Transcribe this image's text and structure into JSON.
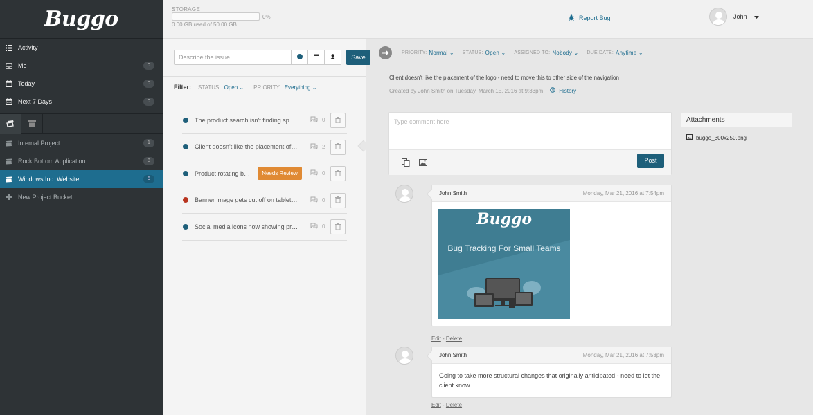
{
  "app": {
    "logo": "Buggo"
  },
  "sidebar": {
    "nav": [
      {
        "label": "Activity",
        "icon": "list-icon",
        "count": null
      },
      {
        "label": "Me",
        "icon": "inbox-icon",
        "count": "0"
      },
      {
        "label": "Today",
        "icon": "calendar-icon",
        "count": "0"
      },
      {
        "label": "Next 7 Days",
        "icon": "calendar-range-icon",
        "count": "0"
      }
    ],
    "projects": [
      {
        "label": "Internal Project",
        "count": "1"
      },
      {
        "label": "Rock Bottom Application",
        "count": "8"
      },
      {
        "label": "Windows Inc. Website",
        "count": "5"
      }
    ],
    "new_project": "New Project Bucket"
  },
  "topbar": {
    "storage_label": "STORAGE",
    "storage_percent": "0%",
    "storage_fraction": 0,
    "storage_used": "0.00 GB used of 50.00 GB",
    "report_bug": "Report Bug",
    "user_name": "John"
  },
  "newbug": {
    "placeholder": "Describe the issue",
    "save": "Save"
  },
  "filter": {
    "label": "Filter:",
    "status_key": "STATUS:",
    "status_val": "Open",
    "priority_key": "PRIORITY:",
    "priority_val": "Everything"
  },
  "bugs": [
    {
      "title": "The product search isn't finding specif...",
      "color": "#1e5f7a",
      "comments": "0",
      "badge": null
    },
    {
      "title": "Client doesn't like the placement of th...",
      "color": "#1e5f7a",
      "comments": "2",
      "badge": null
    },
    {
      "title": "Product rotating ba...",
      "color": "#1e5f7a",
      "comments": "0",
      "badge": "Needs Review"
    },
    {
      "title": "Banner image gets cut off on tablet sit...",
      "color": "#b8341f",
      "comments": "0",
      "badge": null
    },
    {
      "title": "Social media icons now showing prop...",
      "color": "#1e5f7a",
      "comments": "0",
      "badge": null
    }
  ],
  "detail": {
    "priority_key": "PRIORITY:",
    "priority_val": "Normal",
    "status_key": "STATUS:",
    "status_val": "Open",
    "assigned_key": "ASSIGNED TO:",
    "assigned_val": "Nobody",
    "due_key": "DUE DATE:",
    "due_val": "Anytime",
    "description": "Client doesn't like the placement of the logo - need to move this to other side of the navigation",
    "created": "Created by John Smith on Tuesday, March 15, 2016 at 9:33pm",
    "history": "History",
    "comment_placeholder": "Type comment here",
    "post": "Post"
  },
  "attachments": {
    "title": "Attachments",
    "files": [
      "buggo_300x250.png"
    ]
  },
  "comments": [
    {
      "author": "John Smith",
      "date": "Monday, Mar 21, 2016 at 7:54pm",
      "image": {
        "logo": "Buggo",
        "tagline": "Bug Tracking For Small Teams"
      },
      "edit": "Edit",
      "sep": " - ",
      "delete": "Delete"
    },
    {
      "author": "John Smith",
      "date": "Monday, Mar 21, 2016 at 7:53pm",
      "text": "Going to take more structural changes that originally anticipated - need to let the client know",
      "edit": "Edit",
      "sep": " - ",
      "delete": "Delete"
    }
  ]
}
